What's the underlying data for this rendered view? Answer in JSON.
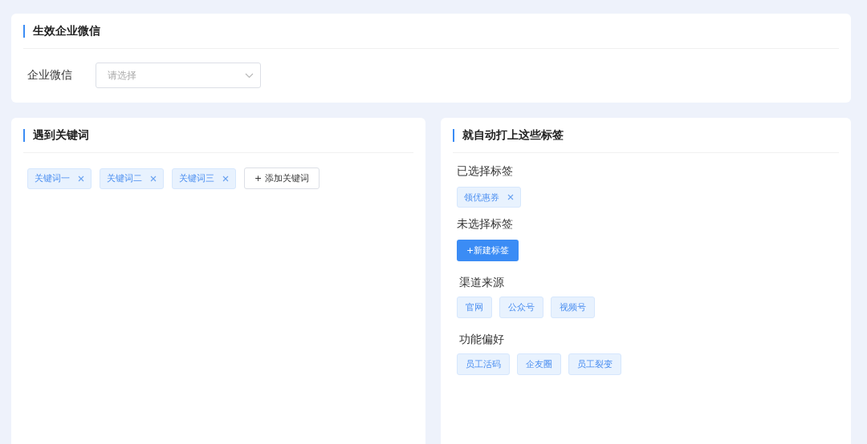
{
  "wechat_section": {
    "title": "生效企业微信",
    "field_label": "企业微信",
    "select": {
      "placeholder": "请选择"
    }
  },
  "keywords_section": {
    "title": "遇到关键词",
    "keywords": [
      "关键词一",
      "关键词二",
      "关键词三"
    ],
    "add_button": "+ 添加关键词"
  },
  "tags_section": {
    "title": "就自动打上这些标签",
    "selected_label": "已选择标签",
    "selected_tags": [
      "领优惠券"
    ],
    "unselected_label": "未选择标签",
    "new_tag_button": "+新建标签",
    "groups": [
      {
        "name": "渠道来源",
        "tags": [
          "官网",
          "公众号",
          "视频号"
        ]
      },
      {
        "name": "功能偏好",
        "tags": [
          "员工活码",
          "企友圈",
          "员工裂变"
        ]
      }
    ]
  }
}
